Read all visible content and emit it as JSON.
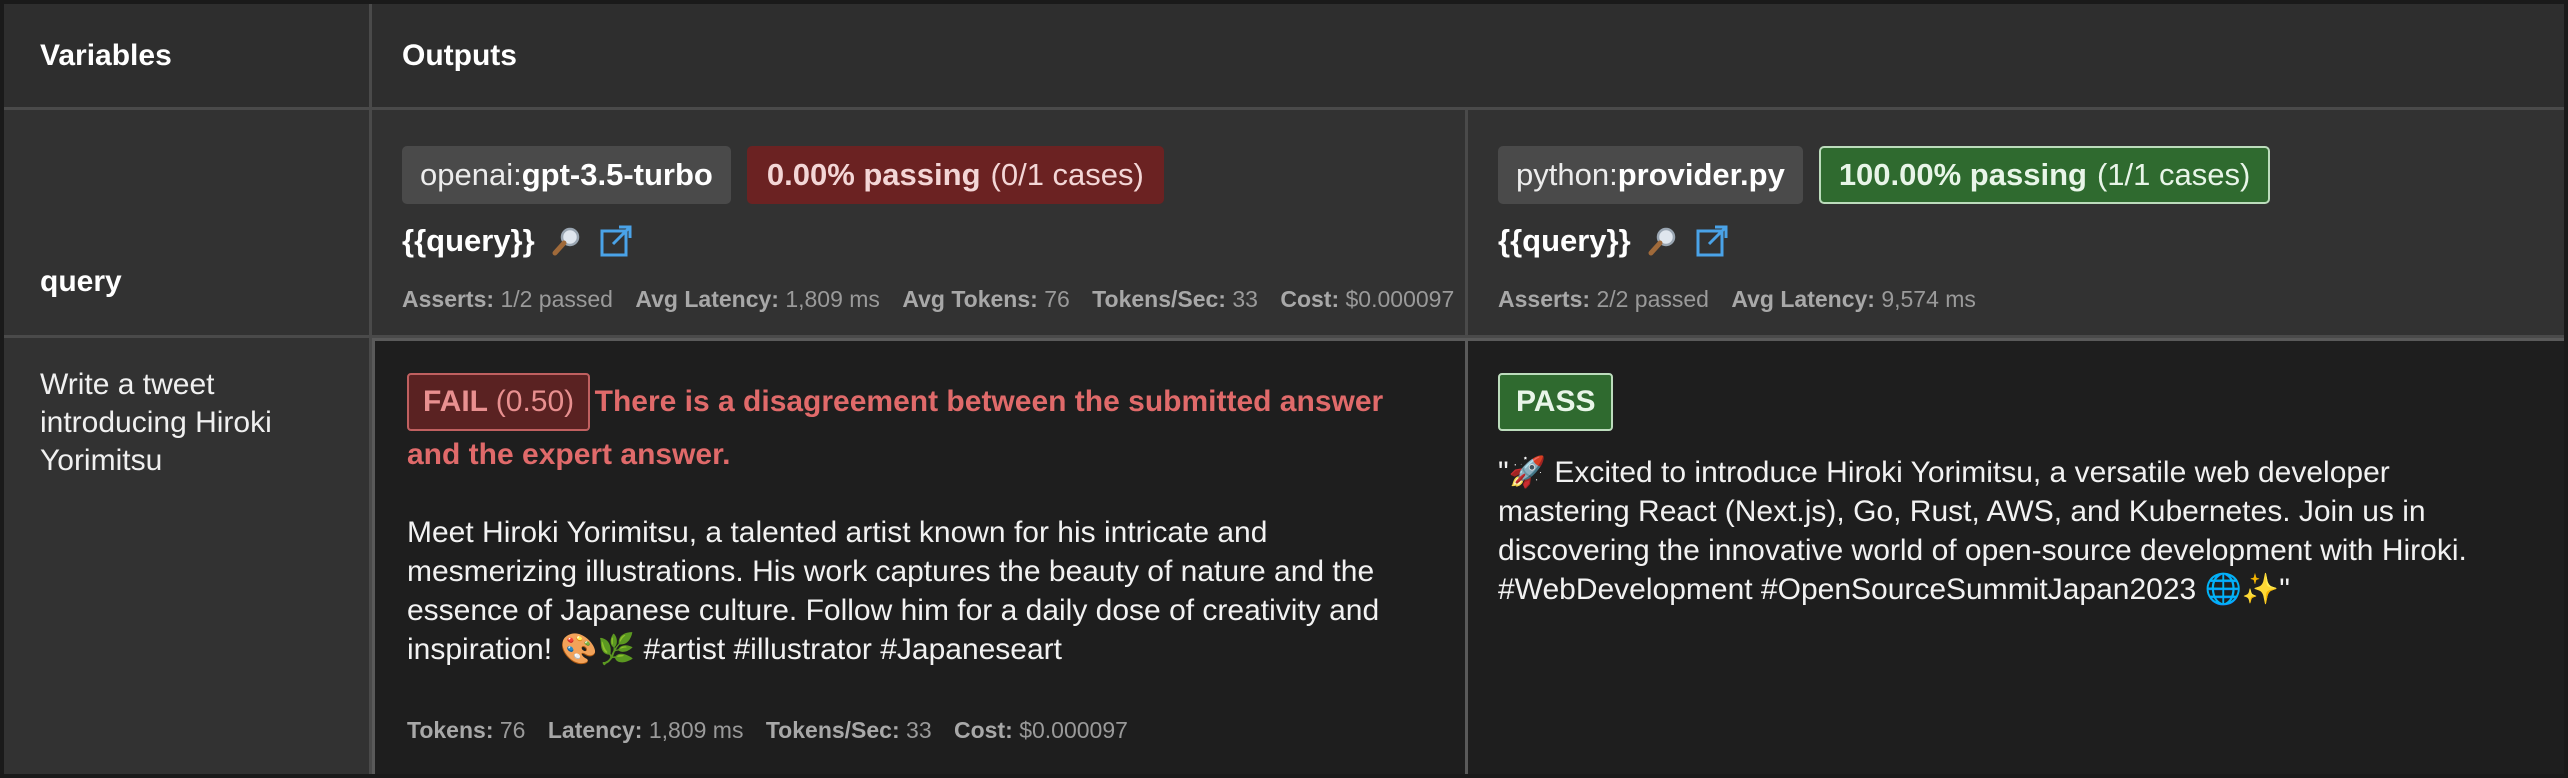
{
  "headers": {
    "variables": "Variables",
    "outputs": "Outputs"
  },
  "variable": {
    "name": "query",
    "value": "Write a tweet introducing Hiroki Yorimitsu"
  },
  "providers": [
    {
      "prefix": "openai:",
      "name": "gpt-3.5-turbo",
      "pass_pct": "0.00% passing",
      "pass_cases": "(0/1 cases)",
      "prompt": "{{query}}",
      "stats": {
        "asserts_label": "Asserts:",
        "asserts": "1/2 passed",
        "latency_label": "Avg Latency:",
        "latency": "1,809 ms",
        "tokens_label": "Avg Tokens:",
        "tokens": "76",
        "tps_label": "Tokens/Sec:",
        "tps": "33",
        "cost_label": "Cost:",
        "cost": "$0.000097"
      }
    },
    {
      "prefix": "python:",
      "name": "provider.py",
      "pass_pct": "100.00% passing",
      "pass_cases": "(1/1 cases)",
      "prompt": "{{query}}",
      "stats": {
        "asserts_label": "Asserts:",
        "asserts": "2/2 passed",
        "latency_label": "Avg Latency:",
        "latency": "9,574 ms"
      }
    }
  ],
  "outputs": [
    {
      "status": "FAIL",
      "score": "(0.50)",
      "reason": "There is a disagreement between the submitted answer and the expert answer.",
      "text": "Meet Hiroki Yorimitsu, a talented artist known for his intricate and mesmerizing illustrations. His work captures the beauty of nature and the essence of Japanese culture. Follow him for a daily dose of creativity and inspiration! 🎨🌿 #artist #illustrator #Japaneseart",
      "stats": {
        "tokens_label": "Tokens:",
        "tokens": "76",
        "latency_label": "Latency:",
        "latency": "1,809 ms",
        "tps_label": "Tokens/Sec:",
        "tps": "33",
        "cost_label": "Cost:",
        "cost": "$0.000097"
      }
    },
    {
      "status": "PASS",
      "text": "\"🚀 Excited to introduce Hiroki Yorimitsu, a versatile web developer mastering React (Next.js), Go, Rust, AWS, and Kubernetes. Join us in discovering the innovative world of open-source development with Hiroki. #WebDevelopment #OpenSourceSummitJapan2023 🌐✨\""
    }
  ],
  "colors": {
    "fail": "#e06a6a",
    "pass_bg": "#2f6a2f",
    "fail_bg": "#6b2222",
    "link": "#4aa3e8"
  },
  "icons": {
    "prompt_magnifier": "magnifier-icon",
    "open_external": "external-link-icon"
  }
}
